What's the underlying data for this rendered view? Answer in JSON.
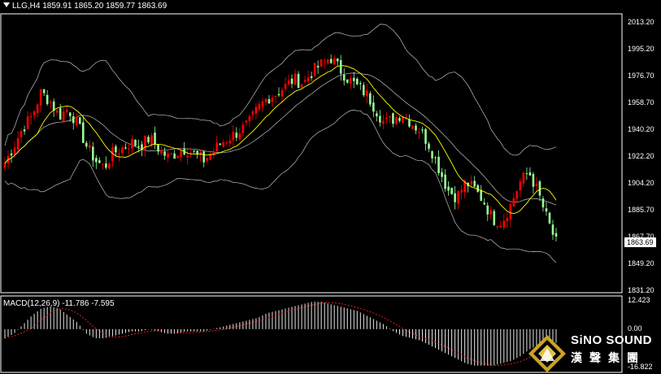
{
  "header": {
    "symbol_line": "LLG,H4  1859.91 1865.20 1859.77 1863.69"
  },
  "macd": {
    "label": "MACD(12,26,9) -11.786 -7.595"
  },
  "price_axis": {
    "ticks": [
      "2013.20",
      "1995.20",
      "1976.70",
      "1958.70",
      "1940.20",
      "1922.20",
      "1904.20",
      "1885.70",
      "1867.70",
      "1849.20",
      "1831.20"
    ],
    "current_price": "1863.69"
  },
  "macd_axis": {
    "ticks": [
      "12.423",
      "0.00",
      "-16.822"
    ]
  },
  "logo": {
    "name": "SiNO SOUND",
    "chinese": "漢聲集團"
  },
  "colors": {
    "up": "#ff0000",
    "down": "#98fb98",
    "ma": "#ffff00",
    "bands": "#c0c0c0",
    "signal": "#ff2020",
    "hist": "#ffffff"
  },
  "chart_data": {
    "type": "candlestick",
    "timeframe": "H4",
    "symbol": "LLG",
    "indicators": [
      "Bollinger Bands",
      "Moving Average",
      "MACD(12,26,9)"
    ],
    "price_range": [
      1831.2,
      2013.2
    ],
    "macd_range": [
      -16.822,
      12.423
    ],
    "close_path": [
      1918,
      1930,
      1942,
      1950,
      1966,
      1960,
      1950,
      1955,
      1945,
      1930,
      1920,
      1915,
      1925,
      1928,
      1932,
      1930,
      1935,
      1928,
      1922,
      1925,
      1928,
      1924,
      1920,
      1926,
      1932,
      1936,
      1940,
      1945,
      1955,
      1962,
      1965,
      1970,
      1975,
      1972,
      1980,
      1985,
      1990,
      1982,
      1975,
      1970,
      1965,
      1955,
      1945,
      1948,
      1952,
      1945,
      1940,
      1930,
      1915,
      1900,
      1895,
      1905,
      1900,
      1892,
      1880,
      1878,
      1890,
      1905,
      1912,
      1898,
      1880,
      1864
    ],
    "macd_hist_path": [
      -4,
      -2,
      2,
      6,
      9,
      10,
      9,
      6,
      3,
      -2,
      -4,
      -4,
      -3,
      -2,
      -1,
      -1,
      0,
      -1,
      -2,
      -2,
      -1,
      -1,
      -1,
      0,
      1,
      2,
      3,
      4,
      5,
      7,
      8,
      9,
      10,
      11,
      12,
      12,
      11,
      10,
      9,
      8,
      6,
      4,
      2,
      -1,
      -3,
      -4,
      -5,
      -7,
      -9,
      -11,
      -13,
      -15,
      -16,
      -16,
      -16,
      -15,
      -14,
      -12,
      -9,
      -7,
      -6,
      -6
    ]
  }
}
